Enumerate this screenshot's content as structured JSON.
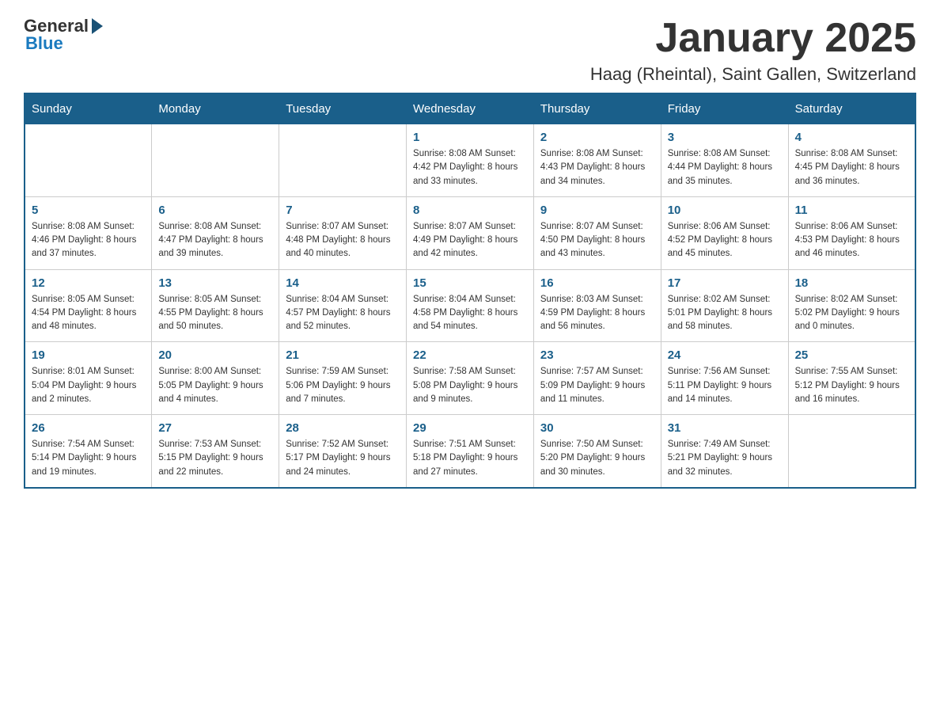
{
  "header": {
    "logo_text": "General",
    "logo_blue": "Blue",
    "month_title": "January 2025",
    "location": "Haag (Rheintal), Saint Gallen, Switzerland"
  },
  "days_of_week": [
    "Sunday",
    "Monday",
    "Tuesday",
    "Wednesday",
    "Thursday",
    "Friday",
    "Saturday"
  ],
  "weeks": [
    [
      {
        "day": "",
        "info": ""
      },
      {
        "day": "",
        "info": ""
      },
      {
        "day": "",
        "info": ""
      },
      {
        "day": "1",
        "info": "Sunrise: 8:08 AM\nSunset: 4:42 PM\nDaylight: 8 hours\nand 33 minutes."
      },
      {
        "day": "2",
        "info": "Sunrise: 8:08 AM\nSunset: 4:43 PM\nDaylight: 8 hours\nand 34 minutes."
      },
      {
        "day": "3",
        "info": "Sunrise: 8:08 AM\nSunset: 4:44 PM\nDaylight: 8 hours\nand 35 minutes."
      },
      {
        "day": "4",
        "info": "Sunrise: 8:08 AM\nSunset: 4:45 PM\nDaylight: 8 hours\nand 36 minutes."
      }
    ],
    [
      {
        "day": "5",
        "info": "Sunrise: 8:08 AM\nSunset: 4:46 PM\nDaylight: 8 hours\nand 37 minutes."
      },
      {
        "day": "6",
        "info": "Sunrise: 8:08 AM\nSunset: 4:47 PM\nDaylight: 8 hours\nand 39 minutes."
      },
      {
        "day": "7",
        "info": "Sunrise: 8:07 AM\nSunset: 4:48 PM\nDaylight: 8 hours\nand 40 minutes."
      },
      {
        "day": "8",
        "info": "Sunrise: 8:07 AM\nSunset: 4:49 PM\nDaylight: 8 hours\nand 42 minutes."
      },
      {
        "day": "9",
        "info": "Sunrise: 8:07 AM\nSunset: 4:50 PM\nDaylight: 8 hours\nand 43 minutes."
      },
      {
        "day": "10",
        "info": "Sunrise: 8:06 AM\nSunset: 4:52 PM\nDaylight: 8 hours\nand 45 minutes."
      },
      {
        "day": "11",
        "info": "Sunrise: 8:06 AM\nSunset: 4:53 PM\nDaylight: 8 hours\nand 46 minutes."
      }
    ],
    [
      {
        "day": "12",
        "info": "Sunrise: 8:05 AM\nSunset: 4:54 PM\nDaylight: 8 hours\nand 48 minutes."
      },
      {
        "day": "13",
        "info": "Sunrise: 8:05 AM\nSunset: 4:55 PM\nDaylight: 8 hours\nand 50 minutes."
      },
      {
        "day": "14",
        "info": "Sunrise: 8:04 AM\nSunset: 4:57 PM\nDaylight: 8 hours\nand 52 minutes."
      },
      {
        "day": "15",
        "info": "Sunrise: 8:04 AM\nSunset: 4:58 PM\nDaylight: 8 hours\nand 54 minutes."
      },
      {
        "day": "16",
        "info": "Sunrise: 8:03 AM\nSunset: 4:59 PM\nDaylight: 8 hours\nand 56 minutes."
      },
      {
        "day": "17",
        "info": "Sunrise: 8:02 AM\nSunset: 5:01 PM\nDaylight: 8 hours\nand 58 minutes."
      },
      {
        "day": "18",
        "info": "Sunrise: 8:02 AM\nSunset: 5:02 PM\nDaylight: 9 hours\nand 0 minutes."
      }
    ],
    [
      {
        "day": "19",
        "info": "Sunrise: 8:01 AM\nSunset: 5:04 PM\nDaylight: 9 hours\nand 2 minutes."
      },
      {
        "day": "20",
        "info": "Sunrise: 8:00 AM\nSunset: 5:05 PM\nDaylight: 9 hours\nand 4 minutes."
      },
      {
        "day": "21",
        "info": "Sunrise: 7:59 AM\nSunset: 5:06 PM\nDaylight: 9 hours\nand 7 minutes."
      },
      {
        "day": "22",
        "info": "Sunrise: 7:58 AM\nSunset: 5:08 PM\nDaylight: 9 hours\nand 9 minutes."
      },
      {
        "day": "23",
        "info": "Sunrise: 7:57 AM\nSunset: 5:09 PM\nDaylight: 9 hours\nand 11 minutes."
      },
      {
        "day": "24",
        "info": "Sunrise: 7:56 AM\nSunset: 5:11 PM\nDaylight: 9 hours\nand 14 minutes."
      },
      {
        "day": "25",
        "info": "Sunrise: 7:55 AM\nSunset: 5:12 PM\nDaylight: 9 hours\nand 16 minutes."
      }
    ],
    [
      {
        "day": "26",
        "info": "Sunrise: 7:54 AM\nSunset: 5:14 PM\nDaylight: 9 hours\nand 19 minutes."
      },
      {
        "day": "27",
        "info": "Sunrise: 7:53 AM\nSunset: 5:15 PM\nDaylight: 9 hours\nand 22 minutes."
      },
      {
        "day": "28",
        "info": "Sunrise: 7:52 AM\nSunset: 5:17 PM\nDaylight: 9 hours\nand 24 minutes."
      },
      {
        "day": "29",
        "info": "Sunrise: 7:51 AM\nSunset: 5:18 PM\nDaylight: 9 hours\nand 27 minutes."
      },
      {
        "day": "30",
        "info": "Sunrise: 7:50 AM\nSunset: 5:20 PM\nDaylight: 9 hours\nand 30 minutes."
      },
      {
        "day": "31",
        "info": "Sunrise: 7:49 AM\nSunset: 5:21 PM\nDaylight: 9 hours\nand 32 minutes."
      },
      {
        "day": "",
        "info": ""
      }
    ]
  ]
}
